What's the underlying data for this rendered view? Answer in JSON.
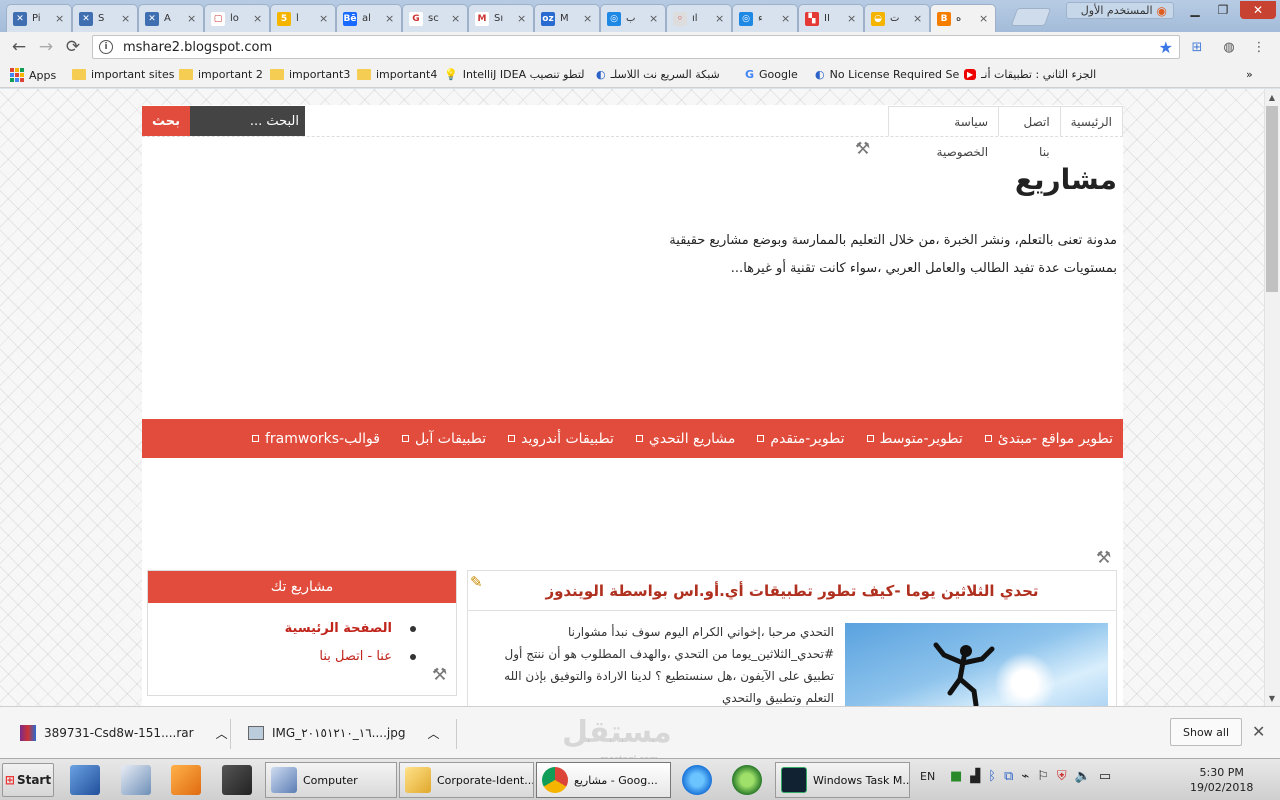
{
  "browser": {
    "tabs": [
      {
        "label": "Pi",
        "fav_bg": "#3f6fb1",
        "fav_glyph": "✕"
      },
      {
        "label": "S",
        "fav_bg": "#3f6fb1",
        "fav_glyph": "✕"
      },
      {
        "label": "A",
        "fav_bg": "#3f6fb1",
        "fav_glyph": "✕"
      },
      {
        "label": "lo",
        "fav_bg": "#ffffff",
        "fav_glyph": "▢"
      },
      {
        "label": "أ",
        "fav_bg": "#f5b400",
        "fav_glyph": "5"
      },
      {
        "label": "al",
        "fav_bg": "#1769ff",
        "fav_glyph": "Bē"
      },
      {
        "label": "sc",
        "fav_bg": "#ffffff",
        "fav_glyph": "G"
      },
      {
        "label": "Sı",
        "fav_bg": "#ffffff",
        "fav_glyph": "M"
      },
      {
        "label": "M",
        "fav_bg": "#2a6bd1",
        "fav_glyph": "oz"
      },
      {
        "label": "ب",
        "fav_bg": "#1e88e5",
        "fav_glyph": "◎"
      },
      {
        "label": "ıl",
        "fav_bg": "#dddddd",
        "fav_glyph": "◦"
      },
      {
        "label": "ء",
        "fav_bg": "#1e88e5",
        "fav_glyph": "◎"
      },
      {
        "label": "II",
        "fav_bg": "#e53935",
        "fav_glyph": "▚"
      },
      {
        "label": "ت",
        "fav_bg": "#f4b400",
        "fav_glyph": "◒"
      },
      {
        "label": "ه",
        "fav_bg": "#f57d00",
        "fav_glyph": "B"
      }
    ],
    "tab_close": "×",
    "profile_label": "المستخدم الأول",
    "url": "mshare2.blogspot.com"
  },
  "bookmarks": [
    {
      "label": "Apps",
      "type": "apps"
    },
    {
      "label": "important sites",
      "type": "folder"
    },
    {
      "label": "important 2",
      "type": "folder"
    },
    {
      "label": "important3",
      "type": "folder"
    },
    {
      "label": "important4",
      "type": "folder"
    },
    {
      "label": "IntelliJ IDEA لتطو تنصيب",
      "type": "bulb"
    },
    {
      "label": "شبكة السريع نت اللاسلـ",
      "type": "site"
    },
    {
      "label": "Google",
      "type": "google"
    },
    {
      "label": "No License Required Se",
      "type": "site"
    },
    {
      "label": "الجزء الثاني : تطبيقات أنـ",
      "type": "youtube"
    }
  ],
  "bookmarks_overflow": "»",
  "blog": {
    "topnav": [
      "الرئيسية",
      "اتصل بنا",
      "سياسة الخصوصية"
    ],
    "search_button": "بحث",
    "search_placeholder": "البحث ...",
    "title": "مشاريع",
    "description": "مدونة تعنى بالتعلم، ونشر الخبرة ،من خلال التعليم بالممارسة وبوضع مشاريع حقيقية بمستويات عدة تفيد الطالب والعامل العربي ،سواء كانت تقنية أو غيرها...",
    "menu": [
      "تطوير مواقع -مبتدئ",
      "تطوير-متوسط",
      "تطوير-متقدم",
      "مشاريع التحدي",
      "تطبيقات أندرويد",
      "تطبيقات آبل",
      "قوالب-framworks"
    ],
    "post": {
      "title": "تحدي الثلاثين يوما -كيف تطور تطبيقات أي.أو.اس بواسطة الويندوز",
      "excerpt": "التحدي مرحبا ،إخواني الكرام اليوم سوف نبدأ مشوارنا #تحدي_الثلاثين_يوما من التحدي ،والهدف المطلوب هو أن ننتج أول تطبيق على الآيفون ،هل سنستطيع ؟ لدينا الارادة والتوفيق بإذن الله التعلم وتطبيق والتحدي"
    },
    "widget": {
      "title": "مشاريع تك",
      "links": [
        "الصفحة الرئيسية",
        "عنا - اتصل بنا"
      ]
    }
  },
  "downloads": {
    "items": [
      "389731-Csd8w-151....rar",
      "IMG_١٦_٢٠١٥١٢١٠....jpg"
    ],
    "show_all": "Show all",
    "watermark": "مستقل",
    "watermark_url": "mostaql.com"
  },
  "taskbar": {
    "start": "Start",
    "tasks": [
      "Computer",
      "Corporate-Ident...",
      "مشاريع - Goog...",
      "Windows Task M..."
    ],
    "lang": "EN",
    "time": "5:30 PM",
    "date": "19/02/2018"
  },
  "colors": {
    "accent": "#e14c3c",
    "post_title": "#b03020"
  }
}
